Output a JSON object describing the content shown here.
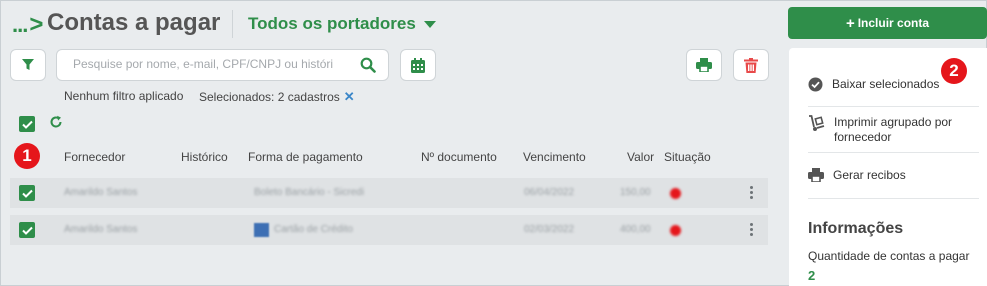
{
  "header": {
    "breadcrumb_dots": "...",
    "breadcrumb_arrow": ">",
    "title": "Contas a pagar",
    "portadores_label": "Todos os portadores"
  },
  "search": {
    "placeholder": "Pesquise por nome, e-mail, CPF/CNPJ ou históri"
  },
  "filters": {
    "status_text": "Nenhum filtro aplicado",
    "selected_text": "Selecionados: 2 cadastros",
    "clear_symbol": "✕"
  },
  "annotations": {
    "marker_1": "1",
    "marker_2": "2"
  },
  "table": {
    "columns": [
      "Fornecedor",
      "Histórico",
      "Forma de pagamento",
      "Nº documento",
      "Vencimento",
      "Valor",
      "Situação"
    ],
    "rows": [
      {
        "checked": true,
        "fornecedor": "Amarildo Santos",
        "historico": "",
        "forma_pagamento": "Boleto Bancário - Sicredi",
        "documento": "",
        "vencimento": "06/04/2022",
        "valor": "150,00",
        "situacao_color": "#e5161b"
      },
      {
        "checked": true,
        "fornecedor": "Amarildo Santos",
        "historico": "",
        "forma_pagamento": "Cartão de Crédito",
        "documento": "",
        "vencimento": "02/03/2022",
        "valor": "400,00",
        "situacao_color": "#e5161b"
      }
    ]
  },
  "sidebar": {
    "add_button": "Incluir conta",
    "actions": [
      {
        "label": "Baixar selecionados",
        "icon": "check-circle-icon"
      },
      {
        "label": "Imprimir agrupado por fornecedor",
        "icon": "dolly-icon"
      },
      {
        "label": "Gerar recibos",
        "icon": "printer-icon"
      }
    ],
    "info_title": "Informações",
    "info_label": "Quantidade de contas a pagar",
    "info_value": "2"
  },
  "colors": {
    "brand_green": "#2f8e4a",
    "danger_red": "#e5161b",
    "link_blue": "#3a86c8"
  }
}
